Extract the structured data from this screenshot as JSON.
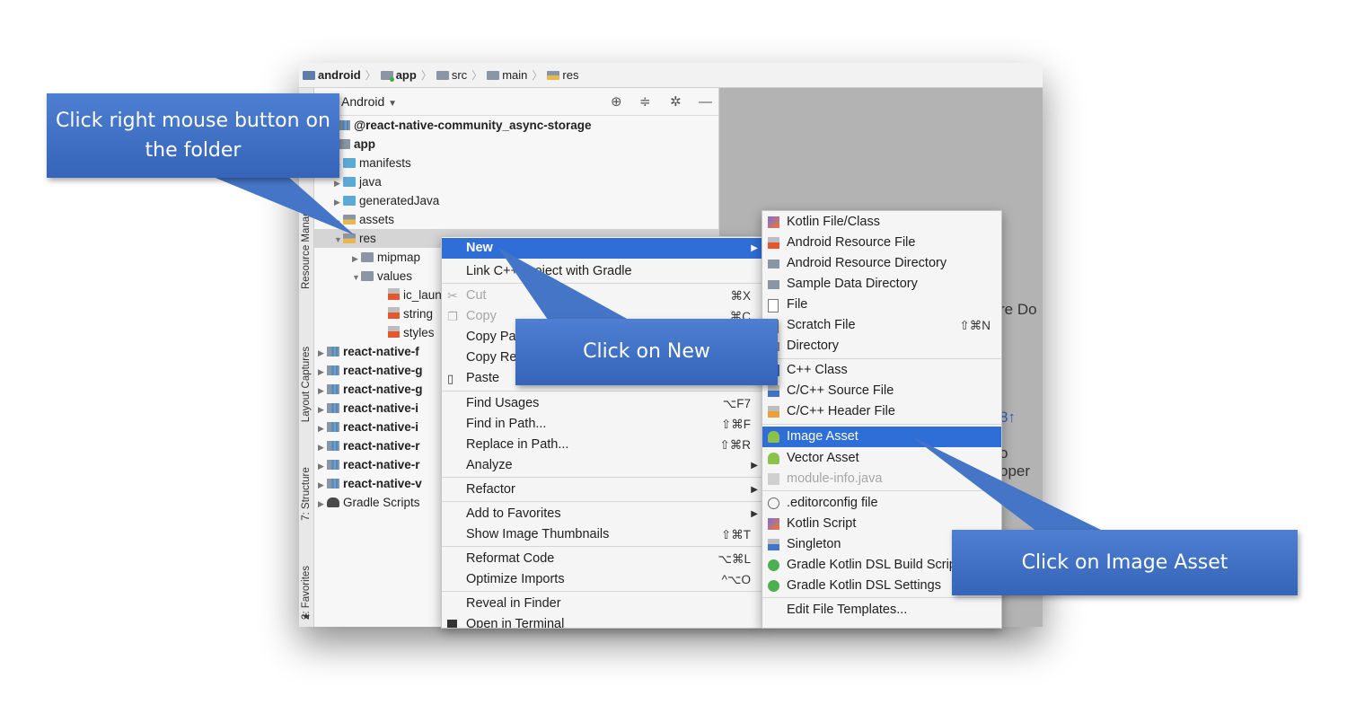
{
  "breadcrumb": [
    {
      "label": "android",
      "bold": true
    },
    {
      "label": "app",
      "bold": true
    },
    {
      "label": "src",
      "bold": false
    },
    {
      "label": "main",
      "bold": false
    },
    {
      "label": "res",
      "bold": false
    }
  ],
  "tool_strip": [
    "Resource Manager",
    "Layout Captures",
    "7: Structure",
    "2: Favorites"
  ],
  "panel": {
    "view_selector": "Android"
  },
  "tree": [
    {
      "label": "@react-native-community_async-storage",
      "bold": true
    },
    {
      "label": "app",
      "bold": true
    },
    {
      "label": "manifests",
      "bold": false
    },
    {
      "label": "java",
      "bold": false
    },
    {
      "label": "generatedJava",
      "bold": false
    },
    {
      "label": "assets",
      "bold": false
    },
    {
      "label": "res",
      "bold": false
    },
    {
      "label": "mipmap",
      "bold": false
    },
    {
      "label": "values",
      "bold": false
    },
    {
      "label": "ic_laun",
      "bold": false
    },
    {
      "label": "string",
      "bold": false
    },
    {
      "label": "styles",
      "bold": false
    },
    {
      "label": "react-native-f",
      "bold": true
    },
    {
      "label": "react-native-g",
      "bold": true
    },
    {
      "label": "react-native-g",
      "bold": true
    },
    {
      "label": "react-native-i",
      "bold": true
    },
    {
      "label": "react-native-i",
      "bold": true
    },
    {
      "label": "react-native-r",
      "bold": true
    },
    {
      "label": "react-native-r",
      "bold": true
    },
    {
      "label": "react-native-v",
      "bold": true
    },
    {
      "label": "Gradle Scripts",
      "bold": false
    }
  ],
  "editor_fragments": [
    "re Do",
    "8↑",
    "o oper"
  ],
  "context_menu": [
    {
      "label": "New",
      "shortcut": "",
      "submenu": true,
      "highlight": true
    },
    {
      "label": "Link C++ Project with Gradle",
      "shortcut": ""
    },
    {
      "label": "Cut",
      "shortcut": "⌘X",
      "disabled": true
    },
    {
      "label": "Copy",
      "shortcut": "⌘C",
      "disabled": true
    },
    {
      "label": "Copy Path",
      "shortcut": ""
    },
    {
      "label": "Copy Reference",
      "shortcut": ""
    },
    {
      "label": "Paste",
      "shortcut": ""
    },
    {
      "label": "Find Usages",
      "shortcut": "⌥F7"
    },
    {
      "label": "Find in Path...",
      "shortcut": "⇧⌘F"
    },
    {
      "label": "Replace in Path...",
      "shortcut": "⇧⌘R"
    },
    {
      "label": "Analyze",
      "shortcut": "",
      "submenu": true
    },
    {
      "label": "Refactor",
      "shortcut": "",
      "submenu": true
    },
    {
      "label": "Add to Favorites",
      "shortcut": "",
      "submenu": true
    },
    {
      "label": "Show Image Thumbnails",
      "shortcut": "⇧⌘T"
    },
    {
      "label": "Reformat Code",
      "shortcut": "⌥⌘L"
    },
    {
      "label": "Optimize Imports",
      "shortcut": "^⌥O"
    },
    {
      "label": "Reveal in Finder",
      "shortcut": ""
    },
    {
      "label": "Open in Terminal",
      "shortcut": ""
    }
  ],
  "submenu": [
    {
      "label": "Kotlin File/Class",
      "shortcut": ""
    },
    {
      "label": "Android Resource File",
      "shortcut": ""
    },
    {
      "label": "Android Resource Directory",
      "shortcut": ""
    },
    {
      "label": "Sample Data Directory",
      "shortcut": ""
    },
    {
      "label": "File",
      "shortcut": ""
    },
    {
      "label": "Scratch File",
      "shortcut": "⇧⌘N"
    },
    {
      "label": "Directory",
      "shortcut": ""
    },
    {
      "label": "C++ Class",
      "shortcut": ""
    },
    {
      "label": "C/C++ Source File",
      "shortcut": ""
    },
    {
      "label": "C/C++ Header File",
      "shortcut": ""
    },
    {
      "label": "Image Asset",
      "shortcut": "",
      "highlight": true
    },
    {
      "label": "Vector Asset",
      "shortcut": ""
    },
    {
      "label": "module-info.java",
      "shortcut": "",
      "disabled": true
    },
    {
      "label": ".editorconfig file",
      "shortcut": ""
    },
    {
      "label": "Kotlin Script",
      "shortcut": ""
    },
    {
      "label": "Singleton",
      "shortcut": ""
    },
    {
      "label": "Gradle Kotlin DSL Build Script",
      "shortcut": ""
    },
    {
      "label": "Gradle Kotlin DSL Settings",
      "shortcut": ""
    },
    {
      "label": "Edit File Templates...",
      "shortcut": ""
    }
  ],
  "callouts": {
    "right_click": "Click right mouse button on the folder",
    "new": "Click on New",
    "image_asset": "Click on Image Asset"
  },
  "colors": {
    "highlight": "#2f6ed6",
    "callout": "#3f6fc3"
  }
}
